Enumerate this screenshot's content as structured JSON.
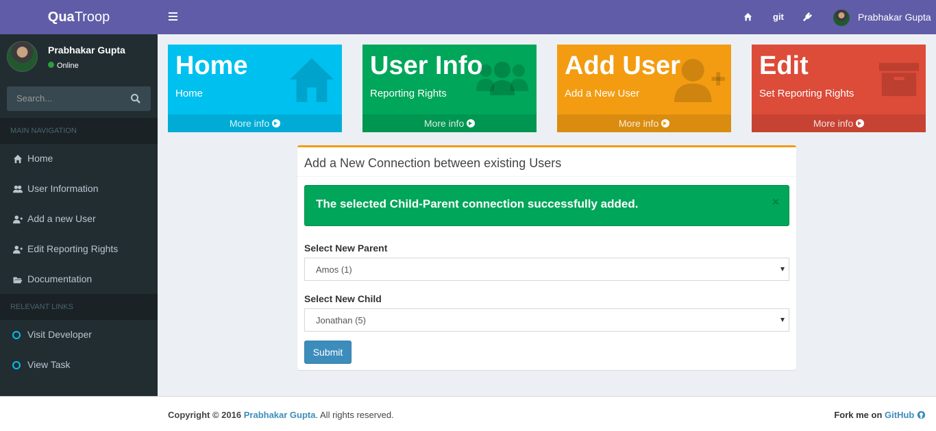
{
  "brand": {
    "bold": "Qua",
    "light": "Troop"
  },
  "user": {
    "name": "Prabhakar Gupta",
    "status": "Online"
  },
  "search": {
    "placeholder": "Search..."
  },
  "sidebar": {
    "main_header": "MAIN NAVIGATION",
    "items": [
      {
        "label": "Home",
        "icon": "home-icon"
      },
      {
        "label": "User Information",
        "icon": "users-icon"
      },
      {
        "label": "Add a new User",
        "icon": "user-plus-icon"
      },
      {
        "label": "Edit Reporting Rights",
        "icon": "user-plus-icon"
      },
      {
        "label": "Documentation",
        "icon": "folder-open-icon"
      }
    ],
    "links_header": "RELEVANT LINKS",
    "links": [
      {
        "label": "Visit Developer"
      },
      {
        "label": "View Task"
      }
    ]
  },
  "topbar": {
    "git": "git",
    "user_name": "Prabhakar Gupta"
  },
  "boxes": [
    {
      "title": "Home",
      "sub": "Home",
      "more": "More info",
      "color": "#00c0ef",
      "icon": "home-icon"
    },
    {
      "title": "User Info",
      "sub": "Reporting Rights",
      "more": "More info",
      "color": "#00a65a",
      "icon": "users-icon"
    },
    {
      "title": "Add User",
      "sub": "Add a New User",
      "more": "More info",
      "color": "#f39c12",
      "icon": "user-plus-icon"
    },
    {
      "title": "Edit",
      "sub": "Set Reporting Rights",
      "more": "More info",
      "color": "#dd4b39",
      "icon": "archive-icon"
    }
  ],
  "panel": {
    "title": "Add a New Connection between existing Users",
    "alert": "The selected Child-Parent connection successfully added.",
    "alert_close": "×",
    "parent_label": "Select New Parent",
    "parent_value": "Amos (1)",
    "child_label": "Select New Child",
    "child_value": "Jonathan (5)",
    "submit": "Submit"
  },
  "footer": {
    "copyright_prefix": "Copyright © 2016",
    "author": "Prabhakar Gupta",
    "suffix": ". All rights reserved.",
    "fork_prefix": "Fork me on",
    "fork_link": "GitHub"
  }
}
